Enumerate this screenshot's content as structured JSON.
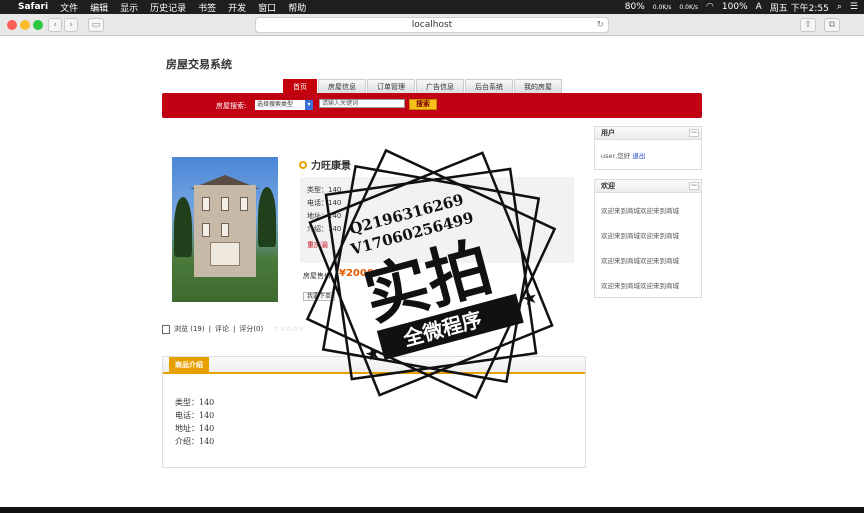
{
  "menubar": {
    "app": "Safari",
    "items": [
      "文件",
      "编辑",
      "显示",
      "历史记录",
      "书签",
      "开发",
      "窗口",
      "帮助"
    ],
    "battery": "80%",
    "battery2": "100%",
    "net_up": "0.0K/s",
    "net_down": "0.0K/s",
    "input_method": "A",
    "clock": "周五 下午2:55"
  },
  "browser": {
    "url": "localhost"
  },
  "site": {
    "title": "房屋交易系统",
    "tabs": [
      "首页",
      "房屋信息",
      "订单管理",
      "广告信息",
      "后台系统",
      "我的房屋"
    ],
    "search_label": "房屋搜索:",
    "search_select": "选择搜索类型",
    "search_placeholder": "请输入关键词",
    "search_button": "搜索"
  },
  "product": {
    "title": "力旺康景",
    "lines": [
      "类型：140",
      "电话：140",
      "地址：140",
      "介绍：140"
    ],
    "location": "重庆渝",
    "price_label": "房屋售价",
    "price": "¥20000",
    "buy_button": "我要下单"
  },
  "stats": {
    "views": "浏览 (19)",
    "comments": "评论",
    "rating": "评分(0)",
    "sep": "|",
    "stars": "☆☆☆☆☆"
  },
  "details": {
    "tab_label": "商品介绍",
    "lines": [
      "类型：140",
      "电话：140",
      "地址：140",
      "介绍：140"
    ]
  },
  "sidebar": {
    "user_title": "用户",
    "user_text": "user,您好",
    "logout": "退出",
    "welcome_title": "欢迎",
    "welcome_items": [
      "欢迎来到商城欢迎来到商城",
      "欢迎来到商城欢迎来到商城",
      "欢迎来到商城欢迎来到商城",
      "欢迎来到商城欢迎来到商城"
    ],
    "min_label": "—"
  },
  "watermark": {
    "contact1": "Q2196316269",
    "contact2": "V17060256499",
    "big": "实拍",
    "band": "全微程序"
  }
}
